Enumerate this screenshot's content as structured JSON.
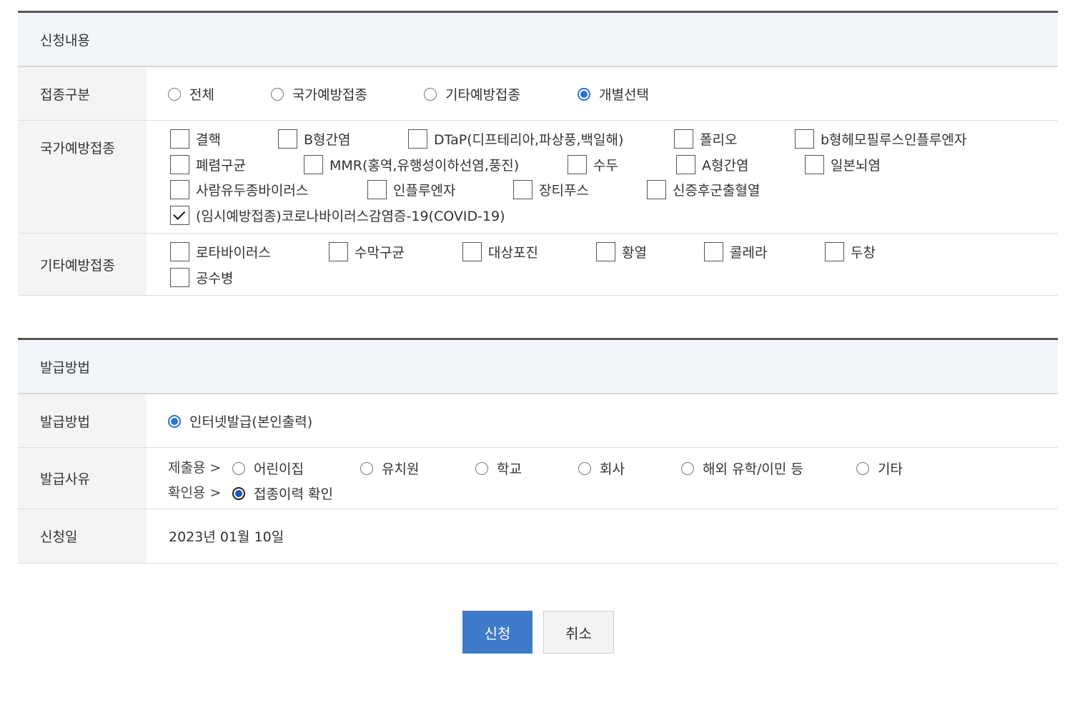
{
  "vaccine_section": {
    "title": "신청내용",
    "type_label": "접종구분",
    "type_options": [
      {
        "label": "전체",
        "checked": false
      },
      {
        "label": "국가예방접종",
        "checked": false
      },
      {
        "label": "기타예방접종",
        "checked": false
      },
      {
        "label": "개별선택",
        "checked": true
      }
    ],
    "national_label": "국가예방접종",
    "national_items": [
      {
        "label": "결핵",
        "checked": false
      },
      {
        "label": "B형간염",
        "checked": false
      },
      {
        "label": "DTaP(디프테리아,파상풍,백일해)",
        "checked": false
      },
      {
        "label": "폴리오",
        "checked": false
      },
      {
        "label": "b형헤모필루스인플루엔자",
        "checked": false
      },
      {
        "label": "폐렴구균",
        "checked": false
      },
      {
        "label": "MMR(홍역,유행성이하선염,풍진)",
        "checked": false
      },
      {
        "label": "수두",
        "checked": false
      },
      {
        "label": "A형간염",
        "checked": false
      },
      {
        "label": "일본뇌염",
        "checked": false
      },
      {
        "label": "사람유두종바이러스",
        "checked": false
      },
      {
        "label": "인플루엔자",
        "checked": false
      },
      {
        "label": "장티푸스",
        "checked": false
      },
      {
        "label": "신증후군출혈열",
        "checked": false
      },
      {
        "label": "(임시예방접종)코로나바이러스감염증-19(COVID-19)",
        "checked": true
      }
    ],
    "other_label": "기타예방접종",
    "other_items": [
      {
        "label": "로타바이러스",
        "checked": false
      },
      {
        "label": "수막구균",
        "checked": false
      },
      {
        "label": "대상포진",
        "checked": false
      },
      {
        "label": "황열",
        "checked": false
      },
      {
        "label": "콜레라",
        "checked": false
      },
      {
        "label": "두창",
        "checked": false
      },
      {
        "label": "공수병",
        "checked": false
      }
    ]
  },
  "issue_section": {
    "title": "발급방법",
    "method_label": "발급방법",
    "method_option": "인터넷발급(본인출력)",
    "reason_label": "발급사유",
    "submit_prefix": "제출용 >",
    "submit_options": [
      {
        "label": "어린이집",
        "checked": false
      },
      {
        "label": "유치원",
        "checked": false
      },
      {
        "label": "학교",
        "checked": false
      },
      {
        "label": "회사",
        "checked": false
      },
      {
        "label": "해외 유학/이민 등",
        "checked": false
      },
      {
        "label": "기타",
        "checked": false
      }
    ],
    "confirm_prefix": "확인용 >",
    "confirm_option": "접종이력 확인",
    "date_label": "신청일",
    "date_value": "2023년 01월 10일"
  },
  "actions": {
    "submit": "신청",
    "cancel": "취소"
  },
  "colors": {
    "primary": "#3f7bc8",
    "radio_checked": "#2a72d6",
    "header_bg": "#f2f6fb",
    "label_bg": "#f4f4f4"
  }
}
